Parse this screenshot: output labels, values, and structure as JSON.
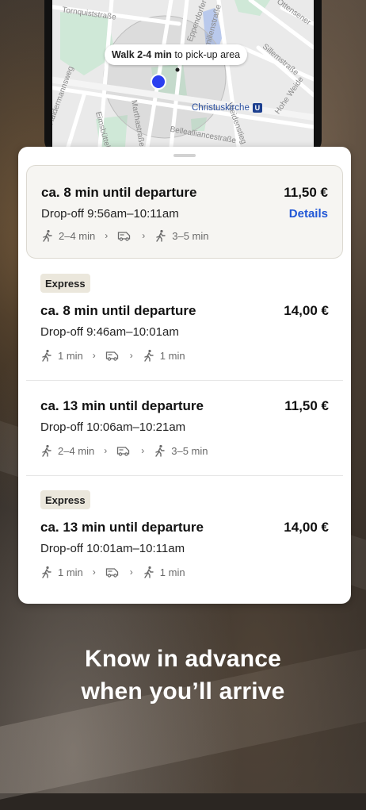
{
  "map": {
    "walk_bold": "Walk 2-4 min",
    "walk_rest": " to pick-up area",
    "station": "Christuskirche",
    "station_badge": "U",
    "streets": [
      "Tornquiststraße",
      "Eppendorfer Weg",
      "Hohe Weide",
      "Bellealliancestraße",
      "Weidenstieg",
      "Emilienstraße",
      "Marthastraße",
      "Sillemstraße",
      "Ottensener",
      "Haldermannsweg",
      "Eimsbüttel"
    ]
  },
  "options": [
    {
      "badge": "",
      "title": "ca. 8 min until departure",
      "price": "11,50 €",
      "dropoff": "Drop-off 9:56am–10:11am",
      "details": "Details",
      "walk1": "2–4 min",
      "walk2": "3–5 min"
    },
    {
      "badge": "Express",
      "title": "ca. 8 min until departure",
      "price": "14,00 €",
      "dropoff": "Drop-off 9:46am–10:01am",
      "walk1": "1 min",
      "walk2": "1 min"
    },
    {
      "badge": "",
      "title": "ca. 13 min until departure",
      "price": "11,50 €",
      "dropoff": "Drop-off 10:06am–10:21am",
      "walk1": "2–4 min",
      "walk2": "3–5 min"
    },
    {
      "badge": "Express",
      "title": "ca. 13 min until departure",
      "price": "14,00 €",
      "dropoff": "Drop-off 10:01am–10:11am",
      "walk1": "1 min",
      "walk2": "1 min"
    }
  ],
  "tagline": {
    "line1": "Know in advance",
    "line2": "when you’ll arrive"
  },
  "colors": {
    "accent": "#2157d6",
    "location_dot": "#2a3ff0",
    "badge_bg": "#ebe7dc"
  }
}
